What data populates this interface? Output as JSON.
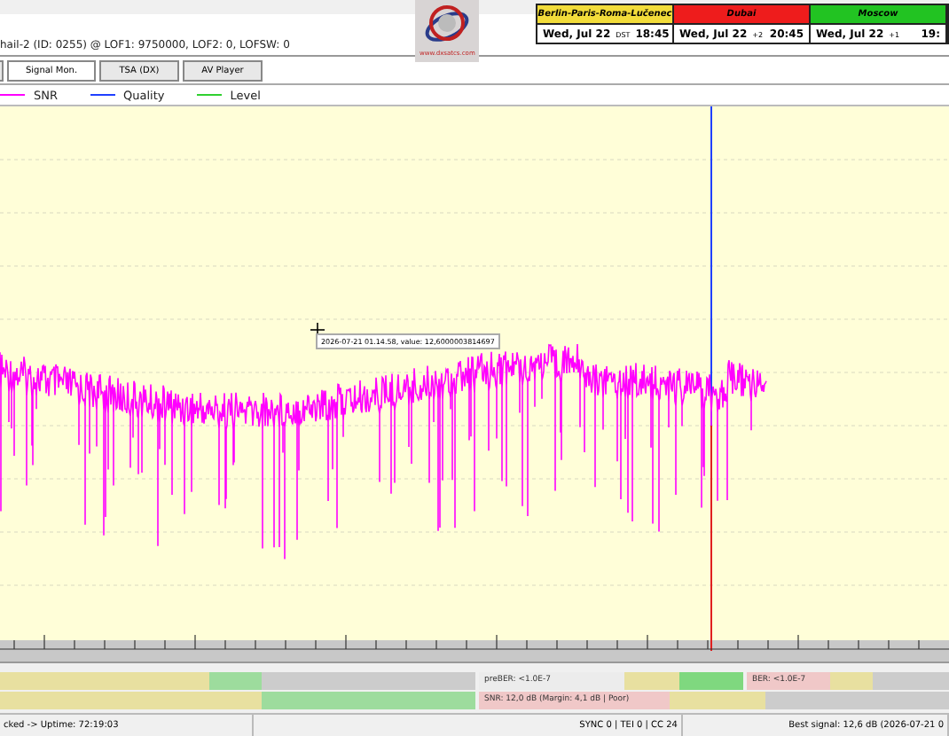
{
  "header": {
    "info": "hail-2 (ID: 0255) @ LOF1: 9750000, LOF2: 0, LOFSW: 0",
    "logo_url": "www.dxsatcs.com"
  },
  "clocks": [
    {
      "city": "Berlin-Paris-Roma-Lučenec",
      "color": "#f2dc3a",
      "date": "Wed, Jul 22",
      "offset": "DST",
      "time": "18:45"
    },
    {
      "city": "Dubai",
      "color": "#ee1c1c",
      "date": "Wed, Jul 22",
      "offset": "+2",
      "time": "20:45"
    },
    {
      "city": "Moscow",
      "color": "#22c322",
      "date": "Wed, Jul 22",
      "offset": "+1",
      "time": "19:"
    }
  ],
  "tabs": [
    {
      "selected": false
    },
    {
      "label": "Signal Mon.",
      "selected": true
    },
    {
      "label": "TSA (DX)",
      "selected": false
    },
    {
      "label": "AV Player",
      "selected": false
    }
  ],
  "legend": [
    {
      "label": "SNR",
      "color": "#ff00ff"
    },
    {
      "label": "Quality",
      "color": "#2040ff"
    },
    {
      "label": "Level",
      "color": "#30d030"
    }
  ],
  "tooltip": "2026-07-21 01.14.58, value: 12,6000003814697",
  "meters": [
    {
      "label": "preBER: <1.0E-7"
    },
    {
      "label": "BER: <1.0E-7"
    },
    {
      "label": "SNR: 12,0 dB (Margin: 4,1 dB | Poor)"
    }
  ],
  "status_bar": [
    "cked -> Uptime: 72:19:03",
    "SYNC 0 | TEI 0 | CC 24",
    "Best signal: 12,6 dB (2026-07-21 0"
  ]
}
